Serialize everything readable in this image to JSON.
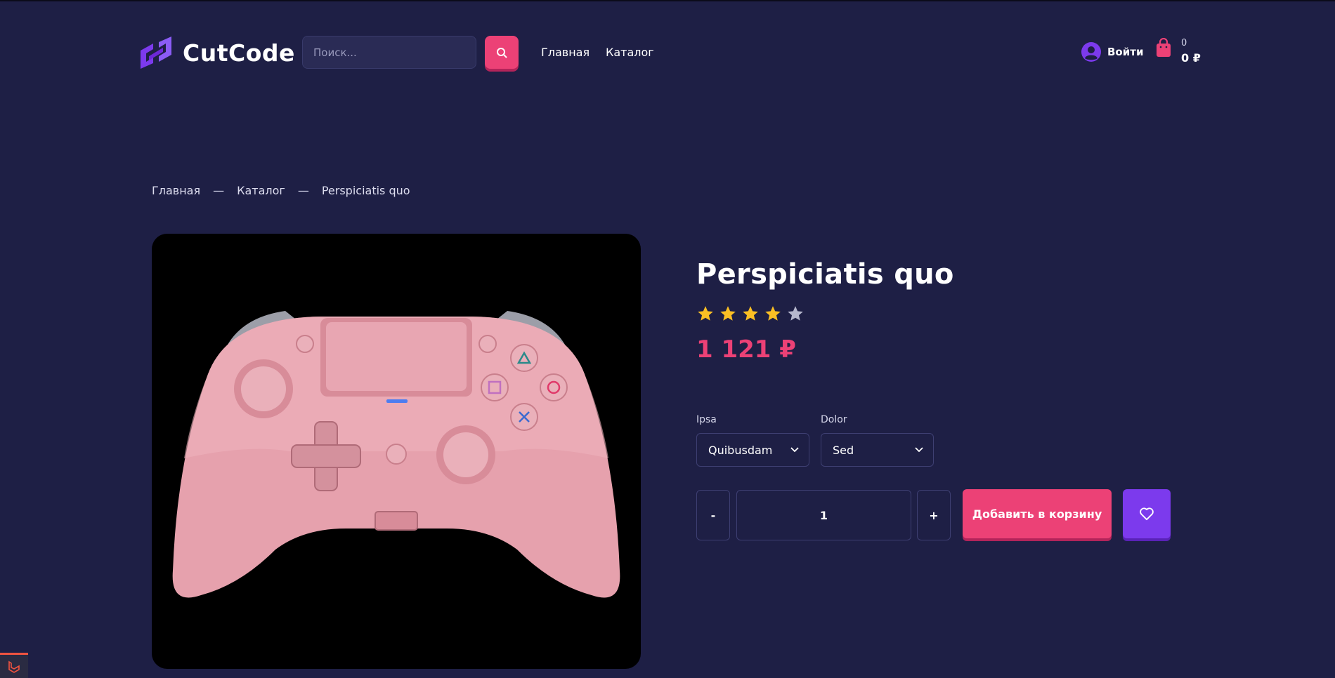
{
  "header": {
    "logo_text": "CutCode",
    "search_placeholder": "Поиск...",
    "nav": [
      {
        "label": "Главная"
      },
      {
        "label": "Каталог"
      }
    ],
    "login_label": "Войти",
    "cart": {
      "count": "0",
      "total": "0 ₽"
    }
  },
  "breadcrumb": {
    "items": [
      "Главная",
      "Каталог",
      "Perspiciatis quo"
    ],
    "separator": "—"
  },
  "product": {
    "title": "Perspiciatis quo",
    "rating": 4,
    "rating_max": 5,
    "price": "1 121 ₽",
    "image": "pink-gamepad-image",
    "options": [
      {
        "label": "Ipsa",
        "value": "Quibusdam"
      },
      {
        "label": "Dolor",
        "value": "Sed"
      }
    ],
    "quantity": {
      "minus_label": "-",
      "value": "1",
      "plus_label": "+"
    },
    "add_to_cart_label": "Добавить в корзину",
    "favorite_icon": "heart-icon"
  },
  "colors": {
    "background": "#1e1f45",
    "accent_pink": "#ec4176",
    "accent_purple": "#7c3aed",
    "star_active": "#fbbf24",
    "star_inactive": "#b6b7cd"
  }
}
